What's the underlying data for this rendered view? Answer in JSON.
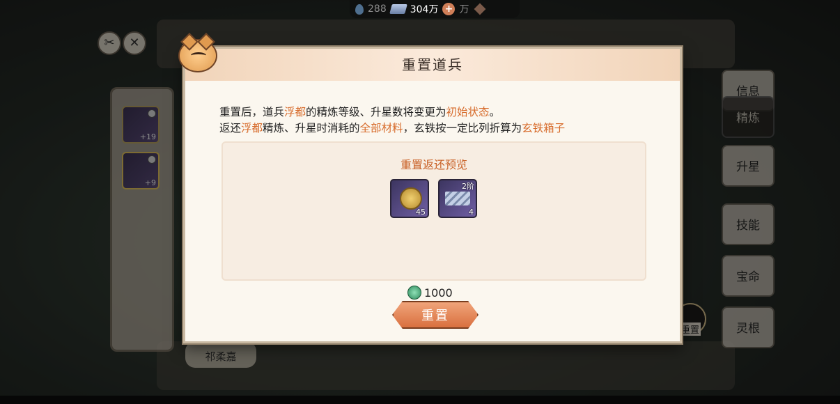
{
  "resources": {
    "spirit_stone": "288",
    "silver": "304万",
    "other": "万"
  },
  "left_panel": {
    "slots": [
      {
        "plus": "+19"
      },
      {
        "plus": "+9"
      }
    ],
    "character_name": "祁柔嘉"
  },
  "right_tabs": [
    "信息",
    "精炼",
    "升星",
    "技能",
    "宝命",
    "灵根"
  ],
  "side_reset_label": "重置",
  "dialog": {
    "title": "重置道兵",
    "line1": [
      {
        "text": "重置后，道兵",
        "highlight": false
      },
      {
        "text": "浮都",
        "highlight": true
      },
      {
        "text": "的精炼等级、升星数将变更为",
        "highlight": false
      },
      {
        "text": "初始状态",
        "highlight": true
      },
      {
        "text": "。",
        "highlight": false
      }
    ],
    "line2": [
      {
        "text": "返还",
        "highlight": false
      },
      {
        "text": "浮都",
        "highlight": true
      },
      {
        "text": "精炼、升星时消耗的",
        "highlight": false
      },
      {
        "text": "全部材料",
        "highlight": true
      },
      {
        "text": "，玄铁按一定比列折算为",
        "highlight": false
      },
      {
        "text": "玄铁箱子",
        "highlight": true
      }
    ],
    "preview_title": "重置返还预览",
    "items": [
      {
        "icon": "gold-seal-icon",
        "count": "45"
      },
      {
        "icon": "iron-bars-icon",
        "count": "4",
        "tier": "2阶"
      }
    ],
    "cost": "1000",
    "reset_button": "重置"
  },
  "colors": {
    "highlight": "#d76b2b",
    "button": "#d9703f"
  }
}
